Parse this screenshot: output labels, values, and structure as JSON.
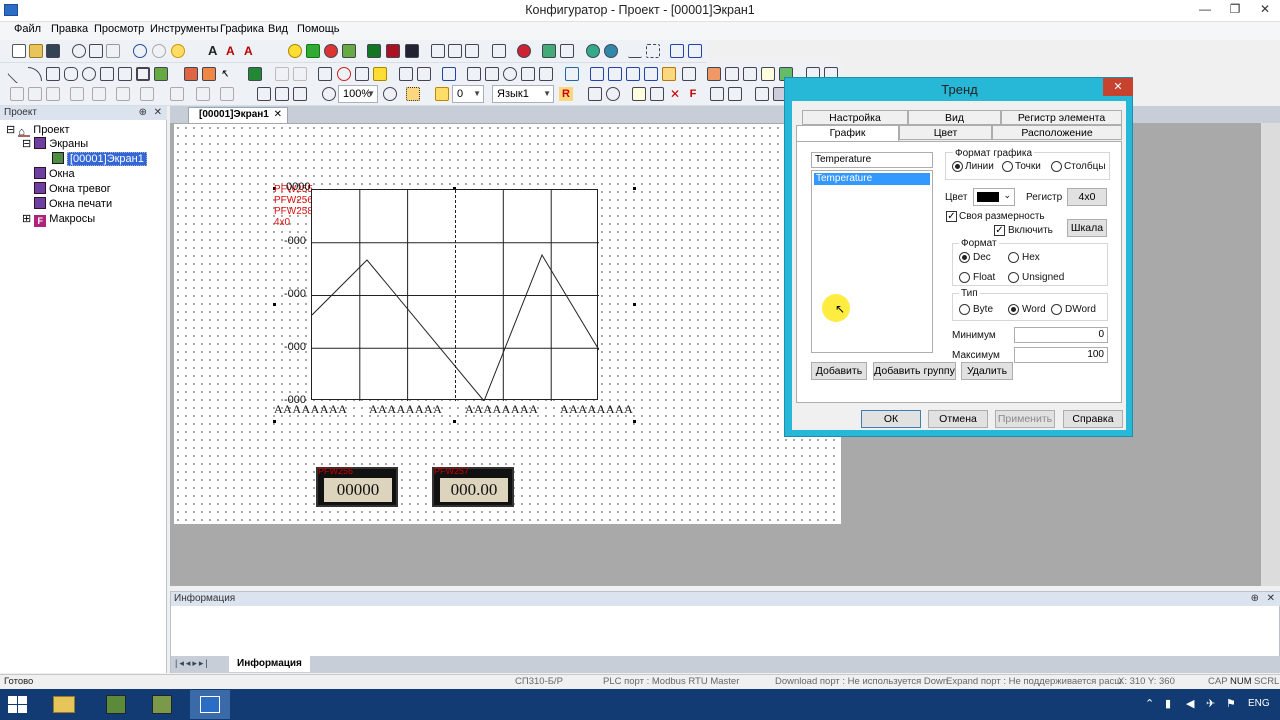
{
  "window": {
    "title": "Конфигуратор - Проект - [00001]Экран1"
  },
  "menu": [
    "Файл",
    "Правка",
    "Просмотр",
    "Инструменты",
    "Графика",
    "Вид",
    "Помощь"
  ],
  "toolbar": {
    "zoom": "100%",
    "layer": "0",
    "language": "Язык1"
  },
  "project_panel": {
    "title": "Проект",
    "tree": [
      {
        "label": "Проект",
        "level": 0,
        "icon": "house-icon"
      },
      {
        "label": "Экраны",
        "level": 1,
        "icon": "screen-icon"
      },
      {
        "label": "[00001]Экран1",
        "level": 2,
        "icon": "screen-icon",
        "selected": true
      },
      {
        "label": "Окна",
        "level": 1,
        "icon": "window-icon"
      },
      {
        "label": "Окна тревог",
        "level": 1,
        "icon": "window-icon"
      },
      {
        "label": "Окна печати",
        "level": 1,
        "icon": "window-icon"
      },
      {
        "label": "Макросы",
        "level": 1,
        "icon": "macro-icon"
      }
    ]
  },
  "editor": {
    "tab": "[00001]Экран1",
    "trend_widget": {
      "register_labels": [
        "PFW255",
        "PFW256",
        "PFW258",
        "4x0"
      ],
      "y_label_top": "0000",
      "y_labels": [
        "-000",
        "-000",
        "-000",
        "-000"
      ],
      "x_labels": [
        "AAAAAAAA",
        "AAAAAAAA",
        "AAAAAAAA",
        "AAAAAAAA"
      ]
    },
    "numeric_displays": [
      {
        "tag": "PFW256",
        "value": "00000"
      },
      {
        "tag": "PFW257",
        "value": "000.00"
      }
    ]
  },
  "info_panel": {
    "title": "Информация",
    "tab": "Информация"
  },
  "status_bar": {
    "ready": "Готово",
    "device": "СП310-Б/Р",
    "plc_port": "PLC порт : Modbus RTU Master",
    "download_port": "Download порт : Не используется Down",
    "expand_port": "Expand порт : Не поддерживается расш",
    "coords": "X: 310  Y: 360",
    "caps": "CAP",
    "num": "NUM",
    "scrl": "SCRL"
  },
  "taskbar": {
    "lang": "ENG"
  },
  "dialog": {
    "title": "Тренд",
    "tabs_row1": [
      "Настройка",
      "Вид",
      "Регистр элемента"
    ],
    "tabs_row2": [
      "График",
      "Цвет",
      "Расположение"
    ],
    "active_tab": "График",
    "series_input": "Temperature",
    "series_list": [
      "Temperature"
    ],
    "chart_format": {
      "label": "Формат графика",
      "options": [
        "Линии",
        "Точки",
        "Столбцы"
      ],
      "selected": "Линии"
    },
    "color_label": "Цвет",
    "color_value": "#000000",
    "register_label": "Регистр",
    "register_value": "4x0",
    "own_dimension": "Своя размерность",
    "enable": "Включить",
    "scale_button": "Шкала",
    "format": {
      "label": "Формат",
      "options": [
        "Dec",
        "Hex",
        "Float",
        "Unsigned"
      ],
      "selected": "Dec"
    },
    "type": {
      "label": "Тип",
      "options": [
        "Byte",
        "Word",
        "DWord"
      ],
      "selected": "Word"
    },
    "min_label": "Минимум",
    "min_value": "0",
    "max_label": "Максимум",
    "max_value": "100",
    "list_buttons": [
      "Добавить",
      "Добавить группу",
      "Удалить"
    ],
    "footer_buttons": {
      "ok": "ОК",
      "cancel": "Отмена",
      "apply": "Применить",
      "help": "Справка"
    }
  }
}
